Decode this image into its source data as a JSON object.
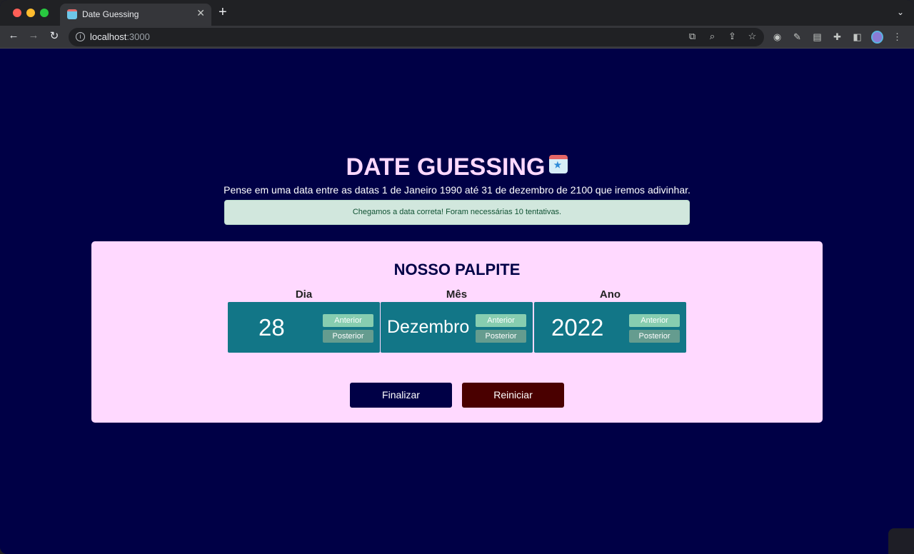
{
  "browser": {
    "tab_title": "Date Guessing",
    "tab_close": "✕",
    "new_tab": "+",
    "url_host": "localhost",
    "url_port": ":3000"
  },
  "page": {
    "title": "DATE GUESSING",
    "subtitle": "Pense em uma data entre as datas 1 de Janeiro 1990 até 31 de dezembro de 2100 que iremos adivinhar.",
    "alert": "Chegamos a data correta! Foram necessárias 10 tentativas.",
    "card_title": "NOSSO PALPITE",
    "columns": [
      {
        "label": "Dia",
        "value": "28",
        "prev": "Anterior",
        "next": "Posterior"
      },
      {
        "label": "Mês",
        "value": "Dezembro",
        "prev": "Anterior",
        "next": "Posterior"
      },
      {
        "label": "Ano",
        "value": "2022",
        "prev": "Anterior",
        "next": "Posterior"
      }
    ],
    "finalize_label": "Finalizar",
    "reset_label": "Reiniciar"
  },
  "colors": {
    "background": "#000046",
    "card": "#ffd9ff",
    "box": "#127687",
    "reset": "#4a0000"
  }
}
